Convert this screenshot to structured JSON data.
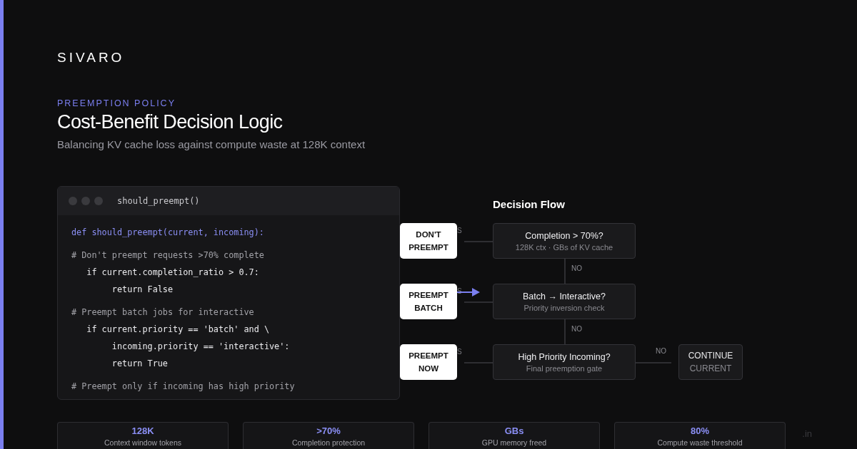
{
  "brand": "SIVARO",
  "eyebrow": "PREEMPTION POLICY",
  "title": "Cost-Benefit Decision Logic",
  "subtitle": "Balancing KV cache loss against compute waste at 128K context",
  "code": {
    "title": "should_preempt()",
    "lines": [
      {
        "kind": "def",
        "text": "def should_preempt(current, incoming):"
      },
      {
        "kind": "comment",
        "text": "# Don't preempt requests >70% complete"
      },
      {
        "kind": "code",
        "text": "   if current.completion_ratio > 0.7:"
      },
      {
        "kind": "code",
        "text": "        return False"
      },
      {
        "kind": "comment",
        "text": "# Preempt batch jobs for interactive"
      },
      {
        "kind": "code",
        "text": "   if current.priority == 'batch' and \\"
      },
      {
        "kind": "code",
        "text": "        incoming.priority == 'interactive':"
      },
      {
        "kind": "code",
        "text": "        return True"
      },
      {
        "kind": "comment",
        "text": "# Preempt only if incoming has high priority"
      }
    ]
  },
  "flow": {
    "title": "Decision Flow",
    "steps": [
      {
        "question": "Completion > 70%?",
        "detail": "128K ctx · GBs of KV cache",
        "outcome": "DON'T PREEMPT",
        "yes_label": "S",
        "highlighted": false,
        "no_label": "NO"
      },
      {
        "question": "Batch → Interactive?",
        "detail": "Priority inversion check",
        "outcome": "PREEMPT BATCH",
        "yes_label": "S",
        "highlighted": true,
        "no_label": "NO"
      },
      {
        "question": "High Priority Incoming?",
        "detail": "Final preemption gate",
        "outcome": "PREEMPT NOW",
        "yes_label": "S",
        "highlighted": false,
        "no_label": "NO"
      }
    ],
    "fallback": {
      "line1": "CONTINUE",
      "line2": "CURRENT"
    }
  },
  "stats": [
    {
      "value": "128K",
      "label": "Context window tokens"
    },
    {
      "value": ">70%",
      "label": "Completion protection"
    },
    {
      "value": "GBs",
      "label": "GPU memory freed"
    },
    {
      "value": "80%",
      "label": "Compute waste threshold"
    }
  ],
  "footer_fragment": ".in"
}
